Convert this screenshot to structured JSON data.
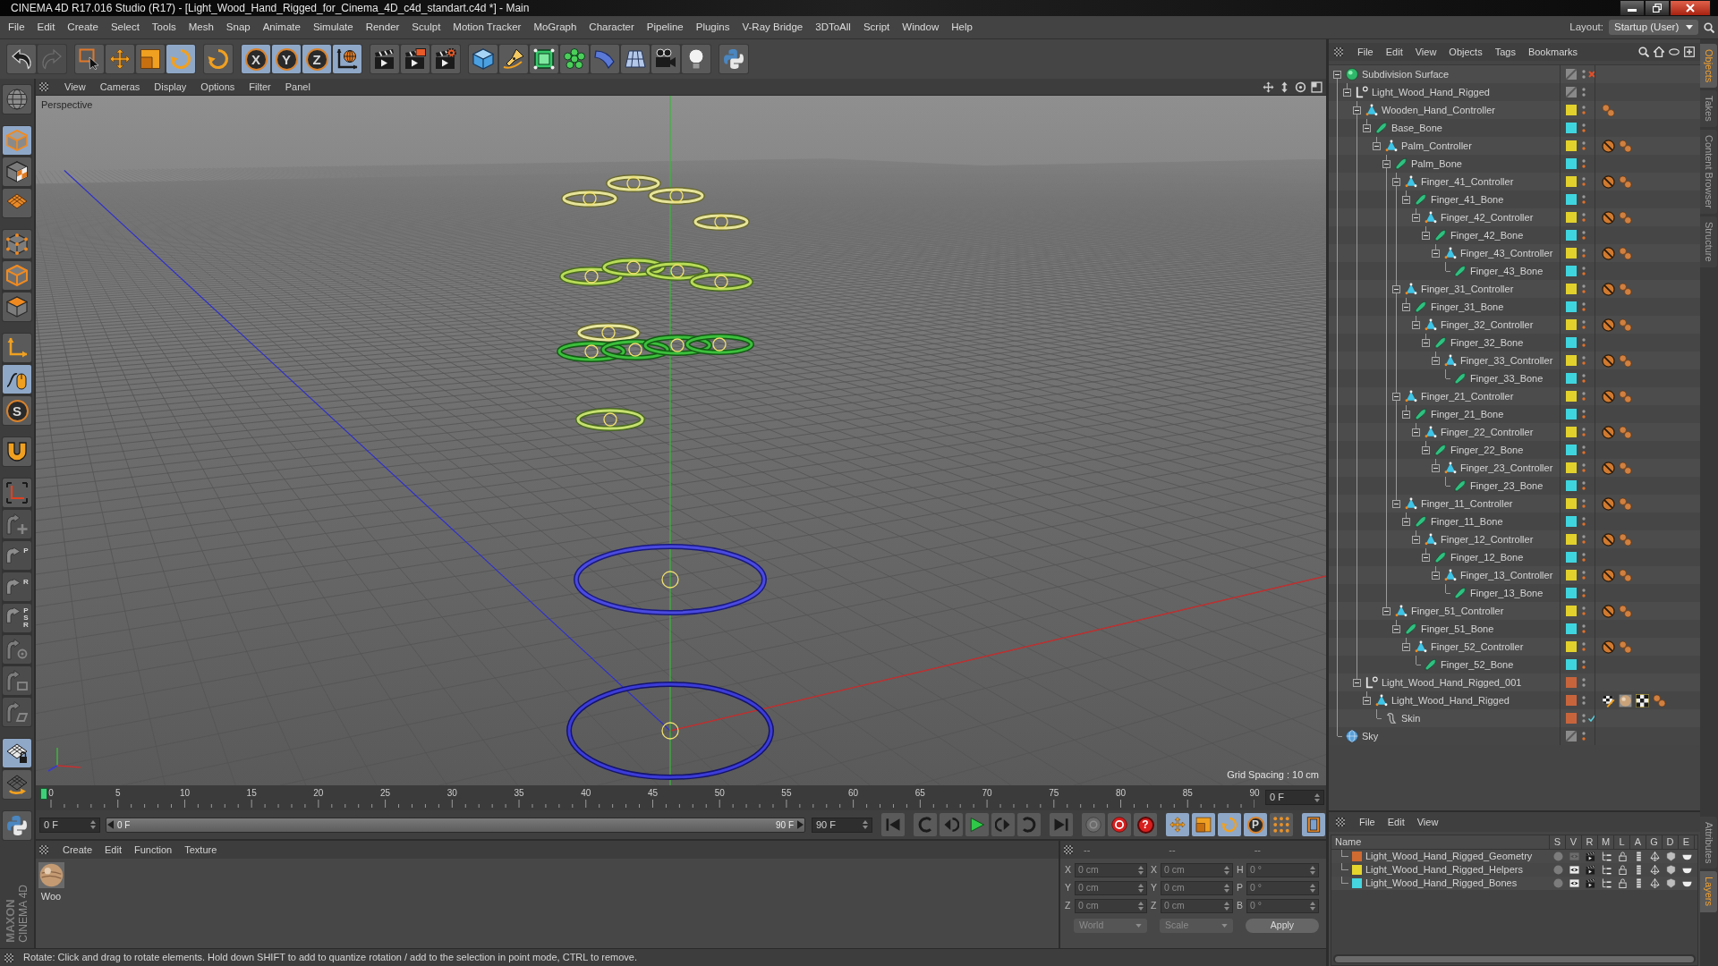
{
  "window": {
    "title": "CINEMA 4D R17.016 Studio (R17) - [Light_Wood_Hand_Rigged_for_Cinema_4D_c4d_standart.c4d *] - Main"
  },
  "menu": [
    "File",
    "Edit",
    "Create",
    "Select",
    "Tools",
    "Mesh",
    "Snap",
    "Animate",
    "Simulate",
    "Render",
    "Sculpt",
    "Motion Tracker",
    "MoGraph",
    "Character",
    "Pipeline",
    "Plugins",
    "V-Ray Bridge",
    "3DToAll",
    "Script",
    "Window",
    "Help"
  ],
  "layout": {
    "label": "Layout:",
    "value": "Startup (User)"
  },
  "toolbar": [
    [
      {
        "kind": "undo",
        "active": false,
        "disabled": false
      },
      {
        "kind": "redo",
        "active": false,
        "disabled": true
      }
    ],
    [
      {
        "kind": "select",
        "active": false,
        "disabled": false
      },
      {
        "kind": "move",
        "active": false,
        "disabled": false
      },
      {
        "kind": "scale",
        "active": false,
        "disabled": false
      },
      {
        "kind": "rotate",
        "active": true,
        "disabled": false
      }
    ],
    [
      {
        "kind": "rotate",
        "active": false,
        "disabled": false
      }
    ],
    [
      {
        "kind": "axis-lock",
        "label": "X",
        "active": true,
        "disabled": false
      },
      {
        "kind": "axis-lock",
        "label": "Y",
        "active": true,
        "disabled": false
      },
      {
        "kind": "axis-lock",
        "label": "Z",
        "active": true,
        "disabled": false
      },
      {
        "kind": "world",
        "active": true,
        "disabled": false
      }
    ],
    [
      {
        "kind": "render-view",
        "active": false,
        "disabled": false
      },
      {
        "kind": "render-picture",
        "active": false,
        "disabled": false
      },
      {
        "kind": "render-settings",
        "active": false,
        "disabled": false
      }
    ],
    [
      {
        "kind": "cube",
        "active": false,
        "disabled": false
      },
      {
        "kind": "pen",
        "active": false,
        "disabled": false
      },
      {
        "kind": "subdivision",
        "active": false,
        "disabled": false
      },
      {
        "kind": "cloner",
        "active": false,
        "disabled": false
      },
      {
        "kind": "deformer",
        "active": false,
        "disabled": false
      },
      {
        "kind": "floor",
        "active": false,
        "disabled": false
      },
      {
        "kind": "camera",
        "active": false,
        "disabled": false
      },
      {
        "kind": "light",
        "active": false,
        "disabled": false
      }
    ],
    [
      {
        "kind": "python",
        "active": false,
        "disabled": false
      }
    ]
  ],
  "left_toolbar": [
    [
      {
        "kind": "globe",
        "active": false,
        "disabled": false
      }
    ],
    [
      {
        "kind": "model",
        "active": true,
        "disabled": false
      },
      {
        "kind": "texture",
        "active": false,
        "disabled": false
      },
      {
        "kind": "workplane",
        "active": false,
        "disabled": false
      }
    ],
    [
      {
        "kind": "points",
        "active": false,
        "disabled": false
      },
      {
        "kind": "edges",
        "active": false,
        "disabled": false
      },
      {
        "kind": "polygons",
        "active": false,
        "disabled": false
      }
    ],
    [
      {
        "kind": "axis-mode",
        "active": false,
        "disabled": false
      },
      {
        "kind": "tweak",
        "active": true,
        "disabled": false
      },
      {
        "kind": "solo",
        "label": "S",
        "active": false,
        "disabled": false
      }
    ],
    [
      {
        "kind": "magnet",
        "active": false,
        "disabled": false
      }
    ],
    [
      {
        "kind": "workplane-axis",
        "active": false,
        "disabled": false
      },
      {
        "kind": "snap-add",
        "active": false,
        "disabled": true
      },
      {
        "kind": "snap",
        "label": "P",
        "active": false,
        "disabled": true
      },
      {
        "kind": "snap",
        "label": "R",
        "active": false,
        "disabled": true
      },
      {
        "kind": "snap",
        "label": "PSR",
        "active": false,
        "disabled": true
      },
      {
        "kind": "snap-target",
        "active": false,
        "disabled": true
      },
      {
        "kind": "snap-box",
        "active": false,
        "disabled": true
      },
      {
        "kind": "snap-plane",
        "active": false,
        "disabled": true
      }
    ],
    [
      {
        "kind": "workplane-lock",
        "active": true,
        "disabled": false
      },
      {
        "kind": "workplane-rotate",
        "active": false,
        "disabled": false
      }
    ],
    [
      {
        "kind": "python",
        "active": false,
        "disabled": false
      }
    ]
  ],
  "logo": {
    "brand": "MAXON",
    "product": "CINEMA 4D"
  },
  "viewport": {
    "menu": [
      "View",
      "Cameras",
      "Display",
      "Options",
      "Filter",
      "Panel"
    ],
    "camera": "Perspective",
    "grid_spacing": "Grid Spacing : 10 cm"
  },
  "timeline": {
    "ticks": [
      "0",
      "5",
      "10",
      "15",
      "20",
      "25",
      "30",
      "35",
      "40",
      "45",
      "50",
      "55",
      "60",
      "65",
      "70",
      "75",
      "80",
      "85",
      "90"
    ],
    "level": 0,
    "frame_field": "0 F"
  },
  "range": {
    "start": "0 F",
    "range_start": "0 F",
    "range_end": "90 F",
    "end": "90 F",
    "level": 1
  },
  "transport": [
    [
      {
        "kind": "go-start",
        "active": false
      }
    ],
    [
      {
        "kind": "prev-key",
        "active": false
      },
      {
        "kind": "prev-frame",
        "active": false
      },
      {
        "kind": "play",
        "active": false
      },
      {
        "kind": "next-frame",
        "active": false
      },
      {
        "kind": "next-key",
        "active": false
      }
    ],
    [
      {
        "kind": "go-end",
        "active": false
      }
    ],
    [
      {
        "kind": "record-off",
        "active": false
      },
      {
        "kind": "record",
        "active": false
      },
      {
        "kind": "key-select",
        "label": "?",
        "active": false
      }
    ],
    [
      {
        "kind": "move",
        "active": true
      },
      {
        "kind": "scale",
        "active": true
      },
      {
        "kind": "rotate",
        "active": true
      },
      {
        "kind": "param",
        "label": "P",
        "active": true
      },
      {
        "kind": "points-grid",
        "active": false
      }
    ],
    [
      {
        "kind": "timeline",
        "active": true
      }
    ]
  ],
  "materials": {
    "menu": [
      "Create",
      "Edit",
      "Function",
      "Texture"
    ],
    "items": [
      {
        "name": "Woo"
      }
    ]
  },
  "coordinates": {
    "headers": [
      "--",
      "--",
      "--"
    ],
    "rows": [
      [
        {
          "axis": "X",
          "value": "0 cm"
        },
        {
          "axis": "X",
          "value": "0 cm"
        },
        {
          "axis": "H",
          "value": "0 °"
        }
      ],
      [
        {
          "axis": "Y",
          "value": "0 cm"
        },
        {
          "axis": "Y",
          "value": "0 cm"
        },
        {
          "axis": "P",
          "value": "0 °"
        }
      ],
      [
        {
          "axis": "Z",
          "value": "0 cm"
        },
        {
          "axis": "Z",
          "value": "0 cm"
        },
        {
          "axis": "B",
          "value": "0 °"
        }
      ]
    ],
    "mode": "World",
    "scale_mode": "Scale",
    "apply": "Apply"
  },
  "status_bar": "Rotate: Click and drag to rotate elements. Hold down SHIFT to add to quantize rotation / add to the selection in point mode, CTRL to remove.",
  "object_manager": {
    "menu": [
      "File",
      "Edit",
      "View",
      "Objects",
      "Tags",
      "Bookmarks"
    ],
    "objects": [
      {
        "name": "Subdivision Surface",
        "kind": "subdivision",
        "render_off": false,
        "enabled": false,
        "expanded": true,
        "children": [
          {
            "name": "Light_Wood_Hand_Rigged",
            "kind": "null",
            "render_off": false,
            "expanded": true,
            "children": [
              {
                "name": "Wooden_Hand_Controller",
                "kind": "polygon",
                "color": "#e2d12c",
                "render_off": true,
                "expanded": true,
                "tags": [
                  {
                    "kind": "constraint"
                  }
                ],
                "children": [
                  {
                    "name": "Base_Bone",
                    "kind": "joint",
                    "color": "#3fd5df",
                    "render_off": true,
                    "expanded": true,
                    "children": [
                      {
                        "name": "Palm_Controller",
                        "kind": "polygon",
                        "color": "#e2d12c",
                        "render_off": true,
                        "expanded": true,
                        "tags": [
                          {
                            "kind": "protection"
                          },
                          {
                            "kind": "constraint"
                          }
                        ],
                        "children": [
                          {
                            "name": "Palm_Bone",
                            "kind": "joint",
                            "color": "#3fd5df",
                            "render_off": true,
                            "expanded": true,
                            "children": [
                              {
                                "name": "Finger_41_Controller",
                                "kind": "polygon",
                                "color": "#e2d12c",
                                "render_off": true,
                                "expanded": true,
                                "tags": [
                                  {
                                    "kind": "protection"
                                  },
                                  {
                                    "kind": "constraint"
                                  }
                                ],
                                "children": [
                                  {
                                    "name": "Finger_41_Bone",
                                    "kind": "joint",
                                    "color": "#3fd5df",
                                    "render_off": true,
                                    "expanded": true,
                                    "children": [
                                      {
                                        "name": "Finger_42_Controller",
                                        "kind": "polygon",
                                        "color": "#e2d12c",
                                        "render_off": true,
                                        "expanded": true,
                                        "tags": [
                                          {
                                            "kind": "protection"
                                          },
                                          {
                                            "kind": "constraint"
                                          }
                                        ],
                                        "children": [
                                          {
                                            "name": "Finger_42_Bone",
                                            "kind": "joint",
                                            "color": "#3fd5df",
                                            "render_off": true,
                                            "expanded": true,
                                            "children": [
                                              {
                                                "name": "Finger_43_Controller",
                                                "kind": "polygon",
                                                "color": "#e2d12c",
                                                "render_off": true,
                                                "expanded": true,
                                                "tags": [
                                                  {
                                                    "kind": "protection"
                                                  },
                                                  {
                                                    "kind": "constraint"
                                                  }
                                                ],
                                                "children": [
                                                  {
                                                    "name": "Finger_43_Bone",
                                                    "kind": "joint",
                                                    "color": "#3fd5df",
                                                    "render_off": true
                                                  }
                                                ]
                                              }
                                            ]
                                          }
                                        ]
                                      }
                                    ]
                                  }
                                ]
                              },
                              {
                                "name": "Finger_31_Controller",
                                "kind": "polygon",
                                "color": "#e2d12c",
                                "render_off": true,
                                "expanded": true,
                                "tags": [
                                  {
                                    "kind": "protection"
                                  },
                                  {
                                    "kind": "constraint"
                                  }
                                ],
                                "children": [
                                  {
                                    "name": "Finger_31_Bone",
                                    "kind": "joint",
                                    "color": "#3fd5df",
                                    "render_off": true,
                                    "expanded": true,
                                    "children": [
                                      {
                                        "name": "Finger_32_Controller",
                                        "kind": "polygon",
                                        "color": "#e2d12c",
                                        "render_off": true,
                                        "expanded": true,
                                        "tags": [
                                          {
                                            "kind": "protection"
                                          },
                                          {
                                            "kind": "constraint"
                                          }
                                        ],
                                        "children": [
                                          {
                                            "name": "Finger_32_Bone",
                                            "kind": "joint",
                                            "color": "#3fd5df",
                                            "render_off": true,
                                            "expanded": true,
                                            "children": [
                                              {
                                                "name": "Finger_33_Controller",
                                                "kind": "polygon",
                                                "color": "#e2d12c",
                                                "render_off": true,
                                                "expanded": true,
                                                "tags": [
                                                  {
                                                    "kind": "protection"
                                                  },
                                                  {
                                                    "kind": "constraint"
                                                  }
                                                ],
                                                "children": [
                                                  {
                                                    "name": "Finger_33_Bone",
                                                    "kind": "joint",
                                                    "color": "#3fd5df",
                                                    "render_off": true
                                                  }
                                                ]
                                              }
                                            ]
                                          }
                                        ]
                                      }
                                    ]
                                  }
                                ]
                              },
                              {
                                "name": "Finger_21_Controller",
                                "kind": "polygon",
                                "color": "#e2d12c",
                                "render_off": true,
                                "expanded": true,
                                "tags": [
                                  {
                                    "kind": "protection"
                                  },
                                  {
                                    "kind": "constraint"
                                  }
                                ],
                                "children": [
                                  {
                                    "name": "Finger_21_Bone",
                                    "kind": "joint",
                                    "color": "#3fd5df",
                                    "render_off": true,
                                    "expanded": true,
                                    "children": [
                                      {
                                        "name": "Finger_22_Controller",
                                        "kind": "polygon",
                                        "color": "#e2d12c",
                                        "render_off": true,
                                        "expanded": true,
                                        "tags": [
                                          {
                                            "kind": "protection"
                                          },
                                          {
                                            "kind": "constraint"
                                          }
                                        ],
                                        "children": [
                                          {
                                            "name": "Finger_22_Bone",
                                            "kind": "joint",
                                            "color": "#3fd5df",
                                            "render_off": true,
                                            "expanded": true,
                                            "children": [
                                              {
                                                "name": "Finger_23_Controller",
                                                "kind": "polygon",
                                                "color": "#e2d12c",
                                                "render_off": true,
                                                "expanded": true,
                                                "tags": [
                                                  {
                                                    "kind": "protection"
                                                  },
                                                  {
                                                    "kind": "constraint"
                                                  }
                                                ],
                                                "children": [
                                                  {
                                                    "name": "Finger_23_Bone",
                                                    "kind": "joint",
                                                    "color": "#3fd5df",
                                                    "render_off": true
                                                  }
                                                ]
                                              }
                                            ]
                                          }
                                        ]
                                      }
                                    ]
                                  }
                                ]
                              },
                              {
                                "name": "Finger_11_Controller",
                                "kind": "polygon",
                                "color": "#e2d12c",
                                "render_off": true,
                                "expanded": true,
                                "tags": [
                                  {
                                    "kind": "protection"
                                  },
                                  {
                                    "kind": "constraint"
                                  }
                                ],
                                "children": [
                                  {
                                    "name": "Finger_11_Bone",
                                    "kind": "joint",
                                    "color": "#3fd5df",
                                    "render_off": true,
                                    "expanded": true,
                                    "children": [
                                      {
                                        "name": "Finger_12_Controller",
                                        "kind": "polygon",
                                        "color": "#e2d12c",
                                        "render_off": true,
                                        "expanded": true,
                                        "tags": [
                                          {
                                            "kind": "protection"
                                          },
                                          {
                                            "kind": "constraint"
                                          }
                                        ],
                                        "children": [
                                          {
                                            "name": "Finger_12_Bone",
                                            "kind": "joint",
                                            "color": "#3fd5df",
                                            "render_off": true,
                                            "expanded": true,
                                            "children": [
                                              {
                                                "name": "Finger_13_Controller",
                                                "kind": "polygon",
                                                "color": "#e2d12c",
                                                "render_off": true,
                                                "expanded": true,
                                                "tags": [
                                                  {
                                                    "kind": "protection"
                                                  },
                                                  {
                                                    "kind": "constraint"
                                                  }
                                                ],
                                                "children": [
                                                  {
                                                    "name": "Finger_13_Bone",
                                                    "kind": "joint",
                                                    "color": "#3fd5df",
                                                    "render_off": true
                                                  }
                                                ]
                                              }
                                            ]
                                          }
                                        ]
                                      }
                                    ]
                                  }
                                ]
                              }
                            ]
                          },
                          {
                            "name": "Finger_51_Controller",
                            "kind": "polygon",
                            "color": "#e2d12c",
                            "render_off": true,
                            "expanded": true,
                            "tags": [
                              {
                                "kind": "protection"
                              },
                              {
                                "kind": "constraint"
                              }
                            ],
                            "children": [
                              {
                                "name": "Finger_51_Bone",
                                "kind": "joint",
                                "color": "#3fd5df",
                                "render_off": true,
                                "expanded": true,
                                "children": [
                                  {
                                    "name": "Finger_52_Controller",
                                    "kind": "polygon",
                                    "color": "#e2d12c",
                                    "render_off": true,
                                    "expanded": true,
                                    "tags": [
                                      {
                                        "kind": "protection"
                                      },
                                      {
                                        "kind": "constraint"
                                      }
                                    ],
                                    "children": [
                                      {
                                        "name": "Finger_52_Bone",
                                        "kind": "joint",
                                        "color": "#3fd5df",
                                        "render_off": true
                                      }
                                    ]
                                  }
                                ]
                              }
                            ]
                          }
                        ]
                      }
                    ]
                  }
                ]
              },
              {
                "name": "Light_Wood_Hand_Rigged_001",
                "kind": "null",
                "color": "#c8643c",
                "render_off": false,
                "expanded": true,
                "children": [
                  {
                    "name": "Light_Wood_Hand_Rigged",
                    "kind": "polygon",
                    "color": "#c8643c",
                    "render_off": false,
                    "expanded": true,
                    "tags": [
                      {
                        "kind": "uvw"
                      },
                      {
                        "kind": "material"
                      },
                      {
                        "kind": "selection"
                      },
                      {
                        "kind": "constraint"
                      }
                    ],
                    "children": [
                      {
                        "name": "Skin",
                        "kind": "skin",
                        "color": "#c8643c",
                        "render_off": false,
                        "enabled": true
                      }
                    ]
                  }
                ]
              }
            ]
          }
        ]
      },
      {
        "name": "Sky",
        "kind": "sky",
        "render_off": true
      }
    ]
  },
  "side_tabs": {
    "top": [
      {
        "label": "Objects",
        "selected": true
      },
      {
        "label": "Takes",
        "selected": false
      },
      {
        "label": "Content Browser",
        "selected": false
      },
      {
        "label": "Structure",
        "selected": false
      }
    ],
    "bottom": [
      {
        "label": "Attributes",
        "selected": false
      },
      {
        "label": "Layers",
        "selected": true
      }
    ]
  },
  "layers": {
    "menu": [
      "File",
      "Edit",
      "View"
    ],
    "columns": [
      {
        "label": "Name",
        "kind": "name"
      },
      {
        "label": "S",
        "kind": "solo"
      },
      {
        "label": "V",
        "kind": "view"
      },
      {
        "label": "R",
        "kind": "render"
      },
      {
        "label": "M",
        "kind": "manager"
      },
      {
        "label": "L",
        "kind": "lock"
      },
      {
        "label": "A",
        "kind": "animation"
      },
      {
        "label": "G",
        "kind": "generators"
      },
      {
        "label": "D",
        "kind": "deformers"
      },
      {
        "label": "E",
        "kind": "expressions"
      }
    ],
    "rows": [
      {
        "name": "Light_Wood_Hand_Rigged_Geometry",
        "color": "#cf6a30",
        "visible": false
      },
      {
        "name": "Light_Wood_Hand_Rigged_Helpers",
        "color": "#e4d62c",
        "visible": true
      },
      {
        "name": "Light_Wood_Hand_Rigged_Bones",
        "color": "#45d6e0",
        "visible": true
      }
    ]
  }
}
